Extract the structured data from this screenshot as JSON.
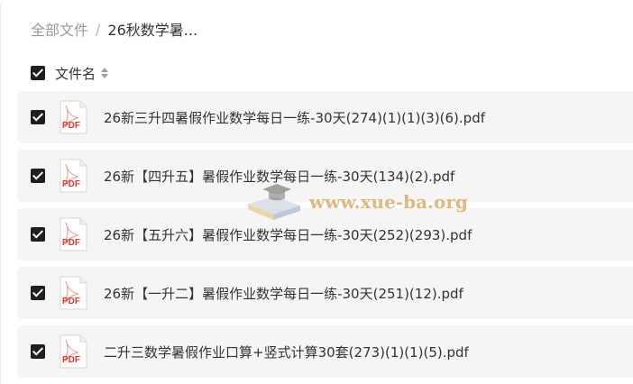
{
  "breadcrumb": {
    "root": "全部文件",
    "separator": "/",
    "current": "26秋数学暑..."
  },
  "list_header": {
    "column_label": "文件名",
    "all_selected": true
  },
  "files": [
    {
      "name": "26新三升四暑假作业数学每日一练-30天(274)(1)(1)(3)(6).pdf",
      "type_label": "PDF",
      "selected": true
    },
    {
      "name": "26新【四升五】暑假作业数学每日一练-30天(134)(2).pdf",
      "type_label": "PDF",
      "selected": true
    },
    {
      "name": "26新【五升六】暑假作业数学每日一练-30天(252)(293).pdf",
      "type_label": "PDF",
      "selected": true
    },
    {
      "name": "26新【一升二】暑假作业数学每日一练-30天(251)(12).pdf",
      "type_label": "PDF",
      "selected": true
    },
    {
      "name": "二升三数学暑假作业口算+竖式计算30套(273)(1)(1)(5).pdf",
      "type_label": "PDF",
      "selected": true
    }
  ],
  "watermark": {
    "text": "www.xue-ba.org"
  },
  "colors": {
    "row_background": "#f5f5f5",
    "checkbox": "#1f1f1f",
    "pdf_red": "#e0362c",
    "watermark": "#d7a55a"
  },
  "icons": {
    "checkbox": "checkbox-checked-icon",
    "sort": "sort-icon",
    "file": "pdf-file-icon"
  }
}
